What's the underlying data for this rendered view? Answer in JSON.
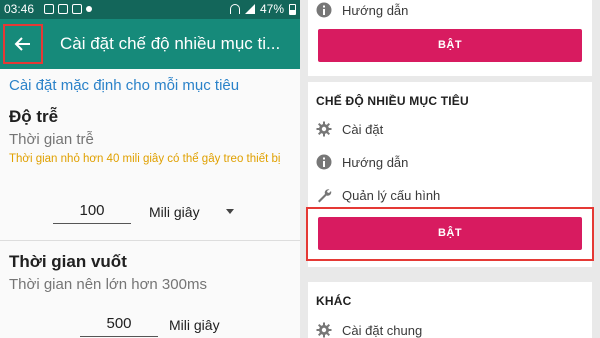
{
  "status_bar": {
    "time": "03:46",
    "battery": "47%",
    "battery_level": 0.47
  },
  "app_bar": {
    "title": "Cài đặt chế độ nhiều mục ti..."
  },
  "settings": {
    "section_link": "Cài đặt mặc định cho mỗi mục tiêu",
    "delay": {
      "title": "Độ trễ",
      "subtitle": "Thời gian trễ",
      "warning": "Thời gian nhỏ hơn 40 mili giây có thể gây treo thiết bị",
      "value": "100",
      "unit": "Mili giây"
    },
    "swipe": {
      "title": "Thời gian vuốt",
      "subtitle": "Thời gian nên lớn hơn 300ms",
      "value": "500",
      "unit": "Mili giây"
    }
  },
  "right_panel": {
    "card1": {
      "guide_label": "Hướng dẫn",
      "button_label": "BẬT"
    },
    "multi_target": {
      "header": "CHẾ ĐỘ NHIỀU MỤC TIÊU",
      "items": [
        {
          "label": "Cài đặt",
          "icon": "gear-icon"
        },
        {
          "label": "Hướng dẫn",
          "icon": "info-icon"
        },
        {
          "label": "Quản lý cấu hình",
          "icon": "wrench-icon"
        }
      ],
      "button_label": "BẬT"
    },
    "other": {
      "header": "KHÁC",
      "items": [
        {
          "label": "Cài đặt chung",
          "icon": "gear-icon"
        }
      ]
    }
  },
  "colors": {
    "app_bar": "#168a7a",
    "status_bar": "#13665a",
    "accent_button": "#d81b60",
    "highlight_border": "#e53935",
    "link": "#2a82c9",
    "warning": "#e0a000"
  }
}
